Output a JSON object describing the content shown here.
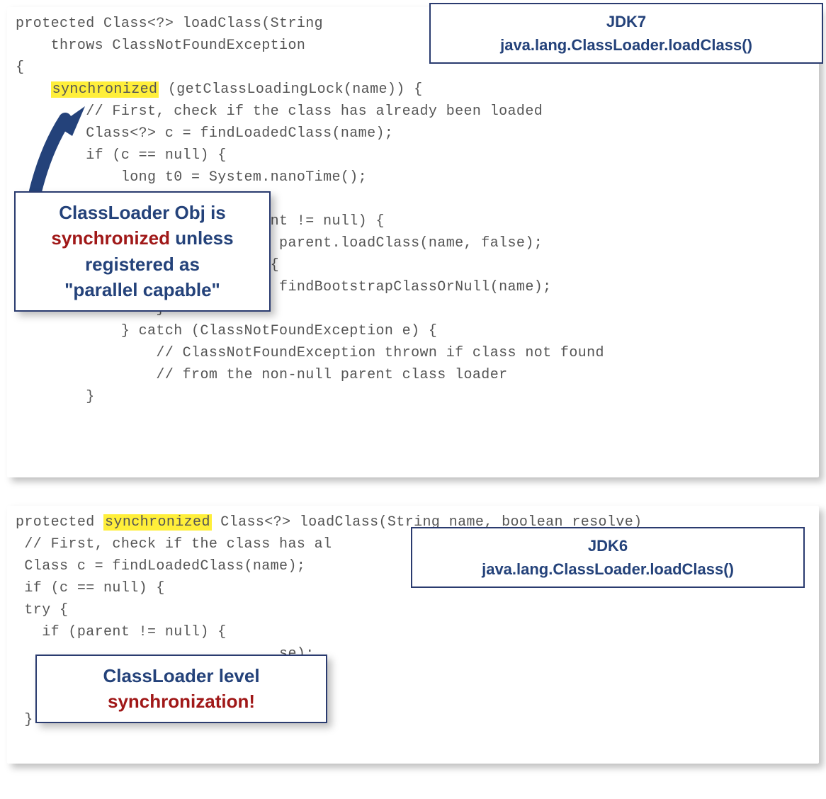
{
  "panel1": {
    "label_title": "JDK7",
    "label_sub": "java.lang.ClassLoader.loadClass()",
    "callout_l1": "ClassLoader Obj is",
    "callout_l2_red": "synchronized",
    "callout_l2_rest": " unless",
    "callout_l3": "registered as",
    "callout_l4": "\"parallel capable\"",
    "code_pre": "protected Class<?> loadClass(String\n    throws ClassNotFoundException\n{\n    ",
    "code_sync": "synchronized",
    "code_mid": " (getClassLoadingLock(name)) {\n        // First, check if the class has already been loaded\n        Class<?> c = findLoadedClass(name);\n        if (c == null) {\n            long t0 = System.nanoTime();\n\n                            ent != null) {\n                              parent.loadClass(name, false);\n                             {\n                              findBootstrapClassOrNull(name);\n                }\n            } catch (ClassNotFoundException e) {\n                // ClassNotFoundException thrown if class not found\n                // from the non-null parent class loader\n        }"
  },
  "panel2": {
    "label_title": "JDK6",
    "label_sub": "java.lang.ClassLoader.loadClass()",
    "callout_l1": "ClassLoader level",
    "callout_l2_red": "synchronization!",
    "code_pre": "protected ",
    "code_sync": "synchronized",
    "code_mid": " Class<?> loadClass(String name, boolean resolve)\n // First, check if the class has al\n Class c = findLoadedClass(name);\n if (c == null) {\n try {\n   if (parent != null) {\n                              se);\n\n                              ame);\n }"
  }
}
